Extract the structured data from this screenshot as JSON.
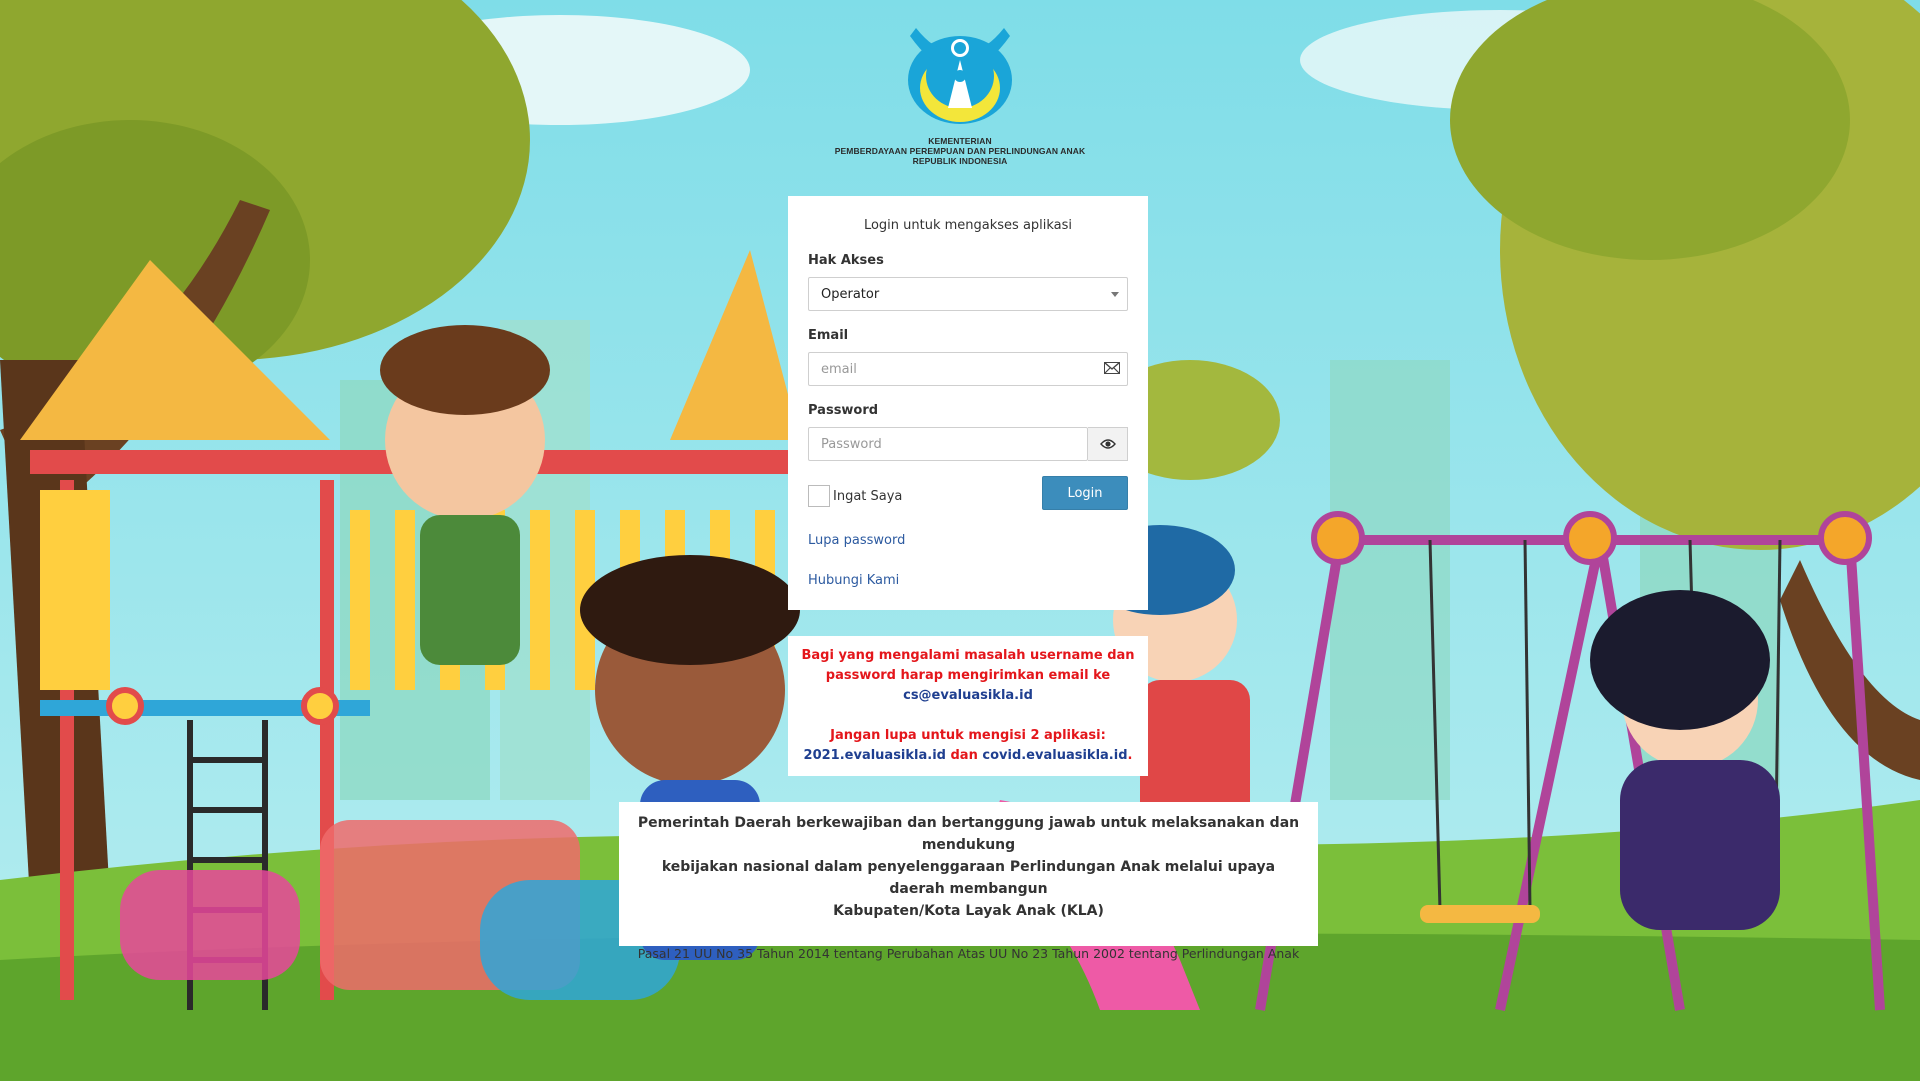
{
  "logo": {
    "line1": "KEMENTERIAN",
    "line2": "PEMBERDAYAAN PEREMPUAN DAN PERLINDUNGAN ANAK",
    "line3": "REPUBLIK INDONESIA"
  },
  "login": {
    "title": "Login untuk mengakses aplikasi",
    "role_label": "Hak Akses",
    "role_value": "Operator",
    "email_label": "Email",
    "email_placeholder": "email",
    "password_label": "Password",
    "password_placeholder": "Password",
    "remember_label": "Ingat Saya",
    "login_button": "Login",
    "forgot_link": "Lupa password",
    "contact_link": "Hubungi Kami"
  },
  "notice": {
    "line1": "Bagi yang mengalami masalah username dan",
    "line2": "password harap mengirimkan email ke",
    "email": "cs@evaluasikla.id",
    "reminder": "Jangan lupa untuk mengisi 2 aplikasi:",
    "app1": "2021.evaluasikla.id",
    "conj": "dan",
    "app2": "covid.evaluasikla.id",
    "period": "."
  },
  "footer": {
    "line1": "Pemerintah Daerah berkewajiban dan bertanggung jawab untuk melaksanakan dan mendukung",
    "line2": "kebijakan nasional dalam penyelenggaraan Perlindungan Anak melalui upaya daerah membangun",
    "line3": "Kabupaten/Kota Layak Anak (KLA)",
    "source": "Pasal 21 UU No 35 Tahun 2014 tentang Perubahan Atas UU No 23 Tahun 2002 tentang Perlindungan Anak"
  },
  "icons": {
    "envelope": "envelope-icon",
    "eye": "eye-icon",
    "caret": "caret-down-icon"
  },
  "colors": {
    "primary_button": "#3c8dbc",
    "notice_red": "#e4161b",
    "notice_blue": "#1f3f90",
    "link": "#2c5aa0"
  }
}
